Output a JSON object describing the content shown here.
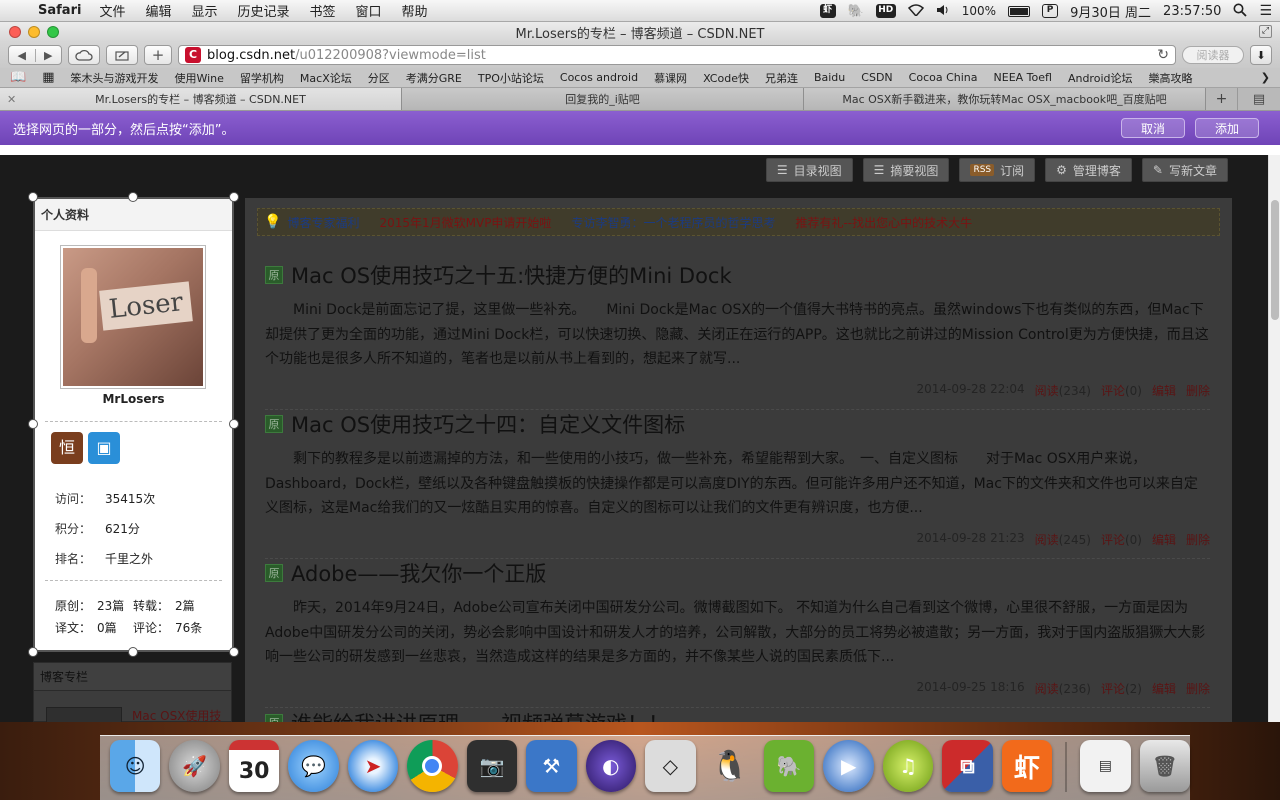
{
  "menubar": {
    "app": "Safari",
    "items": [
      "文件",
      "编辑",
      "显示",
      "历史记录",
      "书签",
      "窗口",
      "帮助"
    ],
    "status": {
      "hd": "HD",
      "battery": "100%",
      "p_icon": "P",
      "date": "9月30日 周二",
      "time": "23:57:50"
    }
  },
  "window": {
    "title": "Mr.Losers的专栏 – 博客频道 – CSDN.NET",
    "url_host": "blog.csdn.net",
    "url_path": "/u012200908?viewmode=list",
    "reader": "阅读器",
    "bookmarks": [
      "笨木头与游戏开发",
      "使用Wine",
      "留学机构",
      "MacX论坛",
      "分区",
      "考满分GRE",
      "TPO小站论坛",
      "Cocos android",
      "慕课网",
      "XCode快",
      "兄弟连",
      "Baidu",
      "CSDN",
      "Cocoa China",
      "NEEA Toefl",
      "Android论坛",
      "樂高攻略"
    ],
    "tabs": [
      {
        "label": "Mr.Losers的专栏 – 博客频道 – CSDN.NET",
        "active": true
      },
      {
        "label": "回复我的_i贴吧",
        "active": false
      },
      {
        "label": "Mac OSX新手戳进来，教你玩转Mac OSX_macbook吧_百度贴吧",
        "active": false
      }
    ]
  },
  "clipbar": {
    "instruction": "选择网页的一部分，然后点按“添加”。",
    "cancel": "取消",
    "add": "添加"
  },
  "page": {
    "topnav": [
      "目录视图",
      "摘要视图",
      "订阅",
      "管理博客",
      "写新文章"
    ],
    "rss": "RSS",
    "notices": [
      {
        "text": "博客专家福利",
        "color": "blue"
      },
      {
        "text": "2015年1月微软MVP申请开始啦",
        "color": "red"
      },
      {
        "text": "专访李智勇：一个老程序员的哲学思考",
        "color": "blue"
      },
      {
        "text": "推荐有礼--找出您心中的技术大牛",
        "color": "red"
      }
    ],
    "articles": [
      {
        "tag": "原",
        "title": "Mac OS使用技巧之十五:快捷方便的Mini Dock",
        "summary": "Mini Dock是前面忘记了提，这里做一些补充。　　Mini Dock是Mac OSX的一个值得大书特书的亮点。虽然windows下也有类似的东西，但Mac下却提供了更为全面的功能，通过Mini Dock栏，可以快速切换、隐藏、关闭正在运行的APP。这也就比之前讲过的Mission Control更为方便快捷，而且这个功能也是很多人所不知道的，笔者也是以前从书上看到的，想起来了就写...",
        "date": "2014-09-28 22:04",
        "read_label": "阅读",
        "reads": "(234)",
        "comment_label": "评论",
        "comments": "(0)",
        "edit": "编辑",
        "delete": "删除"
      },
      {
        "tag": "原",
        "title": "Mac OS使用技巧之十四：自定义文件图标",
        "summary": "剩下的教程多是以前遗漏掉的方法，和一些使用的小技巧，做一些补充，希望能帮到大家。　一、自定义图标　　对于Mac OSX用户来说，Dashboard，Dock栏，壁纸以及各种键盘触摸板的快捷操作都是可以高度DIY的东西。但可能许多用户还不知道，Mac下的文件夹和文件也可以来自定义图标，这是Mac给我们的又一炫酷且实用的惊喜。自定义的图标可以让我们的文件更有辨识度，也方便...",
        "date": "2014-09-28 21:23",
        "read_label": "阅读",
        "reads": "(245)",
        "comment_label": "评论",
        "comments": "(0)",
        "edit": "编辑",
        "delete": "删除"
      },
      {
        "tag": "原",
        "title": "Adobe——我欠你一个正版",
        "summary": "昨天，2014年9月24日，Adobe公司宣布关闭中国研发分公司。微博截图如下。 不知道为什么自己看到这个微博，心里很不舒服，一方面是因为Adobe中国研发分公司的关闭，势必会影响中国设计和研发人才的培养，公司解散，大部分的员工将势必被遣散；另一方面，我对于国内盗版猖獗大大影响一些公司的研发感到一丝悲哀，当然造成这样的结果是多方面的，并不像某些人说的国民素质低下...",
        "date": "2014-09-25 18:16",
        "read_label": "阅读",
        "reads": "(236)",
        "comment_label": "评论",
        "comments": "(2)",
        "edit": "编辑",
        "delete": "删除"
      },
      {
        "tag": "原",
        "title": "谁能给我讲讲原理——视频弹幕游戏！！"
      }
    ],
    "profile": {
      "header": "个人资料",
      "username": "MrLosers",
      "avatar_text": "Loser",
      "medal1": "恒",
      "visits_label": "访问：",
      "visits": "35415次",
      "points_label": "积分：",
      "points": "621分",
      "rank_label": "排名：",
      "rank": "千里之外",
      "original_label": "原创：",
      "original": "23篇",
      "reprint_label": "转载：",
      "reprint": "2篇",
      "translate_label": "译文：",
      "translate": "0篇",
      "comments_label": "评论：",
      "comments": "76条"
    },
    "column": {
      "header": "博客专栏",
      "item": "Mac OSX使用技"
    }
  },
  "dock": {
    "calendar_day": "30",
    "app_labels": [
      "Finder",
      "Launchpad",
      "Calendar",
      "Messages",
      "Safari",
      "Chrome",
      "FaceTime",
      "Xcode",
      "Eclipse",
      "Unity",
      "QQ",
      "Evernote",
      "QuickTime",
      "Music",
      "Parallels",
      "Xiami",
      "Screenshot",
      "Trash"
    ],
    "xiami_glyph": "虾"
  },
  "colors": {
    "clipbar": "#7a4cc2",
    "csdn_red": "#c8102e"
  }
}
